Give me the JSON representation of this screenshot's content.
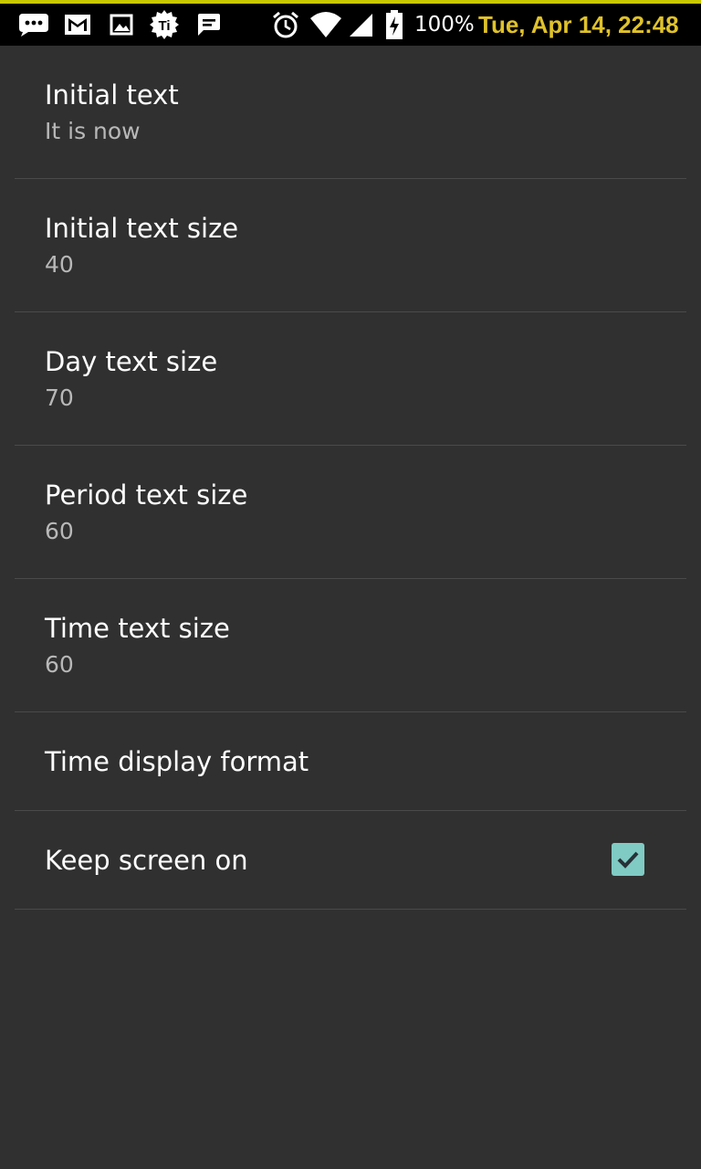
{
  "status_bar": {
    "icons_left": [
      "chat-bubble-icon",
      "gmail-icon",
      "image-icon",
      "titanium-icon",
      "message-icon"
    ],
    "icons_right": [
      "alarm-icon",
      "wifi-icon",
      "signal-icon",
      "battery-charging-icon"
    ],
    "battery": "100%",
    "datetime": "Tue, Apr 14, 22:48",
    "datetime_color": "#e0c22a"
  },
  "preferences": [
    {
      "title": "Initial text",
      "summary": "It is now"
    },
    {
      "title": "Initial text size",
      "summary": "40"
    },
    {
      "title": "Day text size",
      "summary": "70"
    },
    {
      "title": "Period text size",
      "summary": "60"
    },
    {
      "title": "Time text size",
      "summary": "60"
    },
    {
      "title": "Time display format"
    },
    {
      "title": "Keep screen on",
      "checked": true
    }
  ],
  "colors": {
    "background": "#303030",
    "checkbox_accent": "#80cbc4"
  }
}
